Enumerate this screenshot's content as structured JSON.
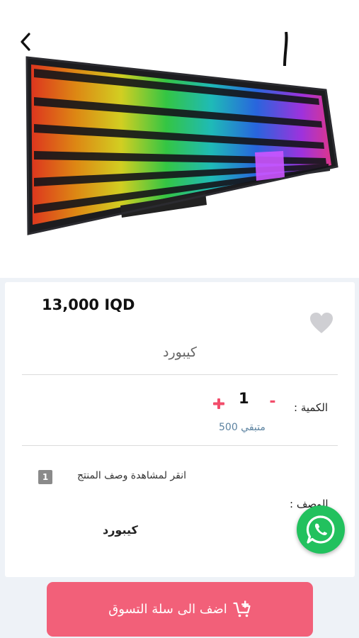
{
  "product": {
    "price": "13,000 IQD",
    "name": "كيبورد"
  },
  "quantity": {
    "label": "الكمية :",
    "minus": "-",
    "value": "1",
    "remaining": "متبقي 500"
  },
  "description": {
    "toggle_text": "انقر لمشاهدة وصف المنتج",
    "badge": "1",
    "label": "الوصف :",
    "value": "كيبورد"
  },
  "cart": {
    "add_label": "اضف الى سلة التسوق"
  },
  "colors": {
    "accent": "#f26079",
    "remaining": "#5b82a0",
    "whatsapp": "#22c15e"
  },
  "icons": [
    "back-arrow-icon",
    "heart-icon",
    "plus-icon",
    "whatsapp-icon",
    "add-to-cart-icon"
  ]
}
